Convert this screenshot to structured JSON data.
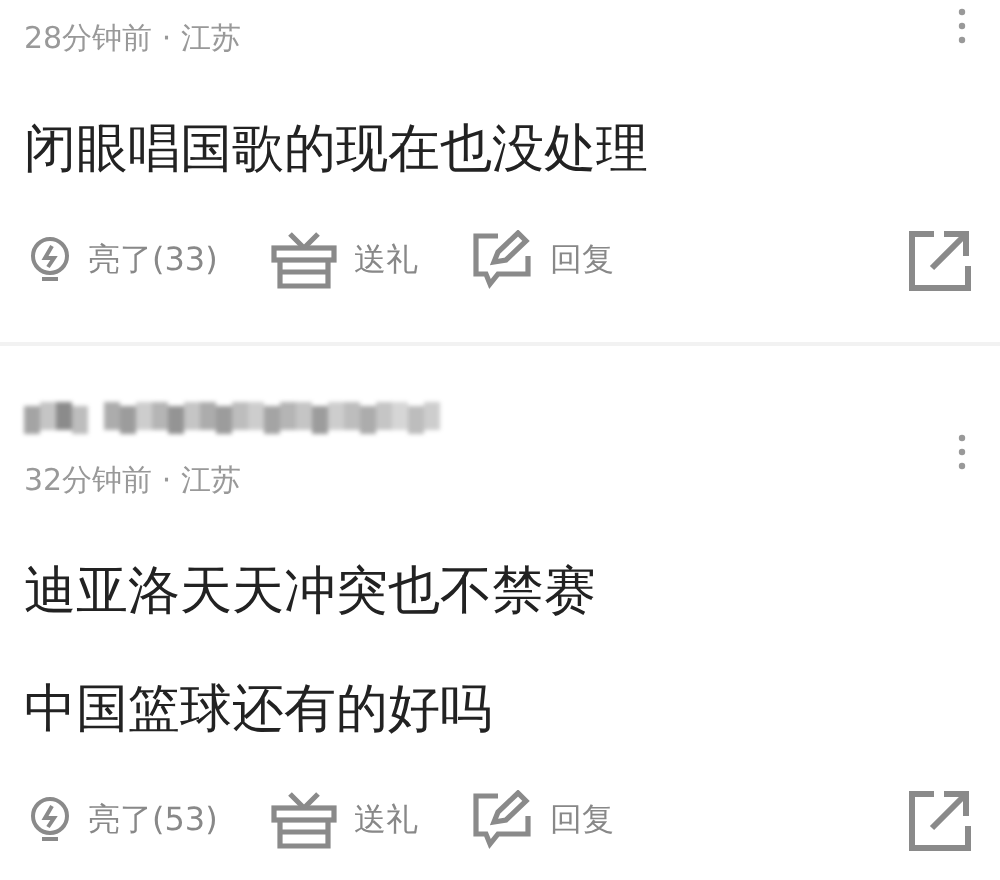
{
  "comments": [
    {
      "meta": "28分钟前 · 江苏",
      "lines": [
        "闭眼唱国歌的现在也没处理"
      ],
      "like": "亮了(33)",
      "gift": "送礼",
      "reply": "回复"
    },
    {
      "username": {
        "kind": "pixelated"
      },
      "meta": "32分钟前 · 江苏",
      "lines": [
        "迪亚洛天天冲突也不禁赛",
        "中国篮球还有的好吗"
      ],
      "like": "亮了(53)",
      "gift": "送礼",
      "reply": "回复"
    }
  ]
}
